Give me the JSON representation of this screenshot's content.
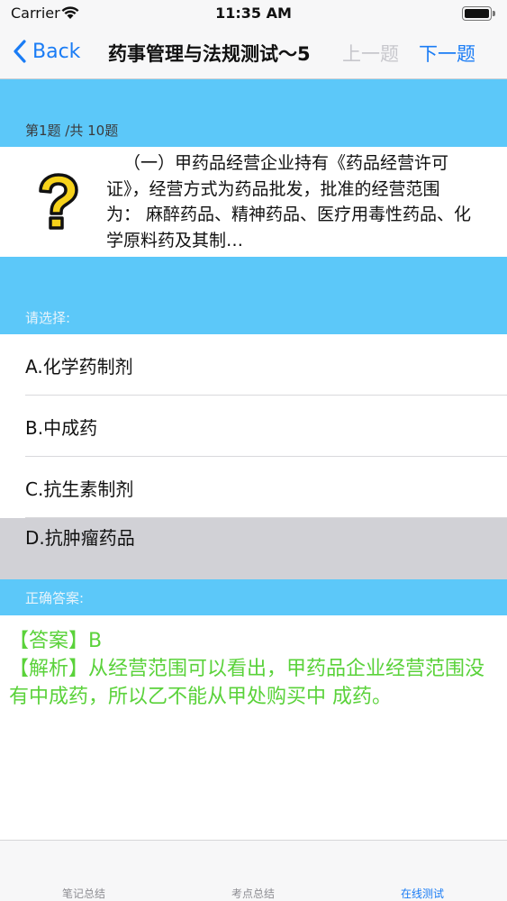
{
  "status": {
    "carrier": "Carrier",
    "time": "11:35 AM"
  },
  "nav": {
    "back_label": "Back",
    "title": "药事管理与法规测试～5",
    "prev_label": "上一题",
    "next_label": "下一题"
  },
  "question": {
    "counter": "第1题 /共 10题",
    "icon": "question-mark-icon",
    "text": "（一）甲药品经营企业持有《药品经营许可证》，经营方式为药品批发，批准的经营范围为： 麻醉药品、精神药品、医疗用毒性药品、化学原料药及其制…"
  },
  "choose_label": "请选择:",
  "options": [
    {
      "label": "A.化学药制剂"
    },
    {
      "label": "B.中成药"
    },
    {
      "label": "C.抗生素制剂"
    },
    {
      "label": "D.抗肿瘤药品"
    }
  ],
  "answer_header": "正确答案:",
  "answer": {
    "answer_line": "【答案】B",
    "analysis": "【解析】从经营范围可以看出，甲药品企业经营范围没有中成药，所以乙不能从甲处购买中 成药。"
  },
  "tabs": [
    {
      "label": "笔记总结"
    },
    {
      "label": "考点总结"
    },
    {
      "label": "在线测试"
    }
  ],
  "colors": {
    "accent": "#1a7cf5",
    "section_bg": "#5cc8f9",
    "answer_text": "#5ad23a",
    "selected_option_bg": "#d1d1d6"
  }
}
